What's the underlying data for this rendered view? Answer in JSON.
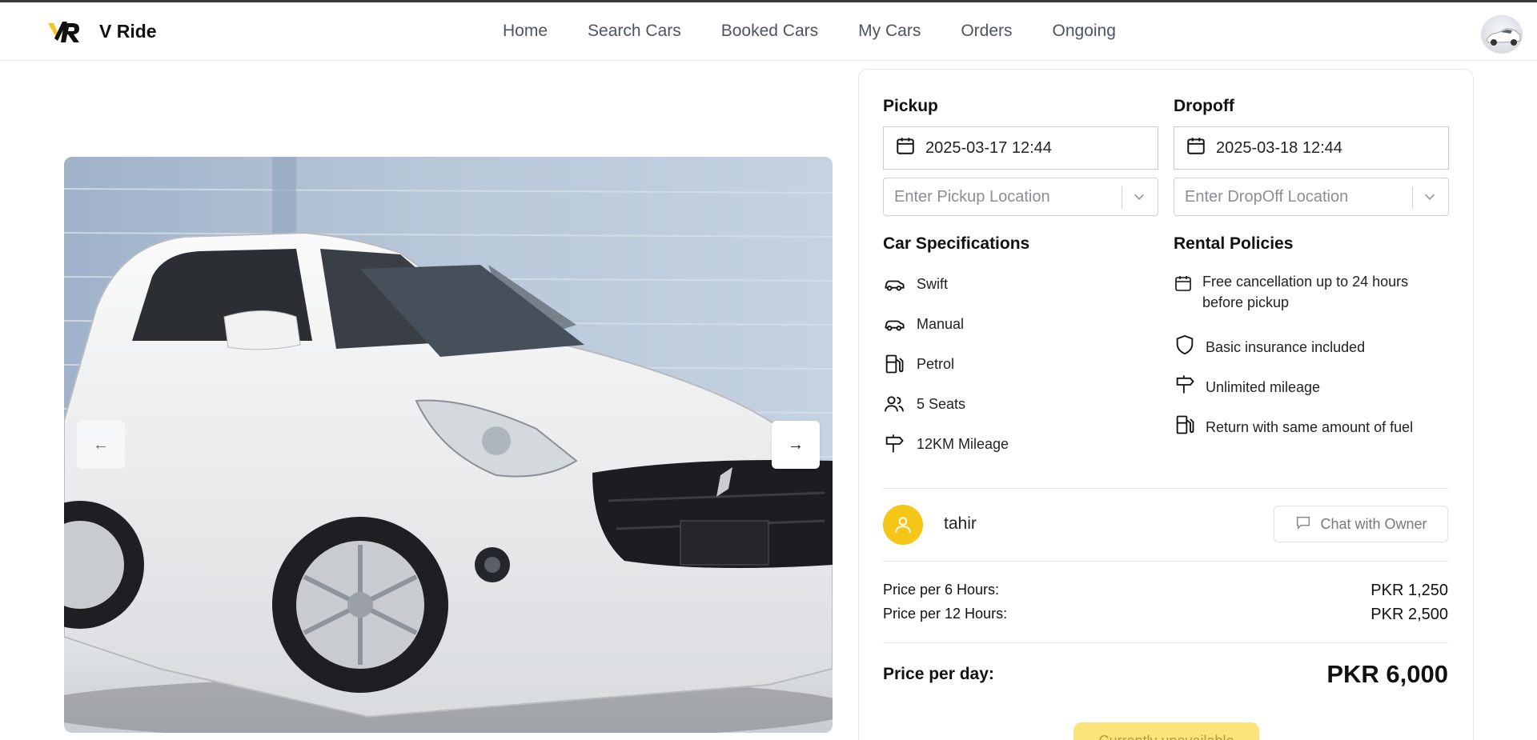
{
  "app": {
    "name": "V Ride"
  },
  "nav": {
    "items": [
      {
        "label": "Home"
      },
      {
        "label": "Search Cars"
      },
      {
        "label": "Booked Cars"
      },
      {
        "label": "My Cars"
      },
      {
        "label": "Orders"
      },
      {
        "label": "Ongoing"
      }
    ]
  },
  "booking": {
    "pickup": {
      "title": "Pickup",
      "datetime": "2025-03-17 12:44",
      "location_placeholder": "Enter Pickup Location"
    },
    "dropoff": {
      "title": "Dropoff",
      "datetime": "2025-03-18 12:44",
      "location_placeholder": "Enter DropOff Location"
    }
  },
  "specs": {
    "title": "Car Specifications",
    "items": [
      {
        "label": "Swift",
        "icon": "car-icon"
      },
      {
        "label": "Manual",
        "icon": "car-icon"
      },
      {
        "label": "Petrol",
        "icon": "fuel-icon"
      },
      {
        "label": "5 Seats",
        "icon": "users-icon"
      },
      {
        "label": "12KM Mileage",
        "icon": "signpost-icon"
      }
    ]
  },
  "policies": {
    "title": "Rental Policies",
    "items": [
      {
        "label": "Free cancellation up to 24 hours before pickup",
        "icon": "calendar-icon"
      },
      {
        "label": "Basic insurance included",
        "icon": "shield-icon"
      },
      {
        "label": "Unlimited mileage",
        "icon": "signpost-icon"
      },
      {
        "label": "Return with same amount of fuel",
        "icon": "fuel-icon"
      }
    ]
  },
  "owner": {
    "name": "tahir",
    "chat_label": "Chat with Owner"
  },
  "pricing": {
    "rows": [
      {
        "label": "Price per 6 Hours:",
        "value": "PKR 1,250"
      },
      {
        "label": "Price per 12 Hours:",
        "value": "PKR 2,500"
      }
    ],
    "day_label": "Price per day:",
    "day_value": "PKR 6,000"
  },
  "cta": {
    "label": "Currently unavailable"
  },
  "colors": {
    "accent_yellow": "#f5c518",
    "button_yellow": "#fde47a",
    "text_dark": "#111111",
    "nav_gray": "#4b5563"
  }
}
